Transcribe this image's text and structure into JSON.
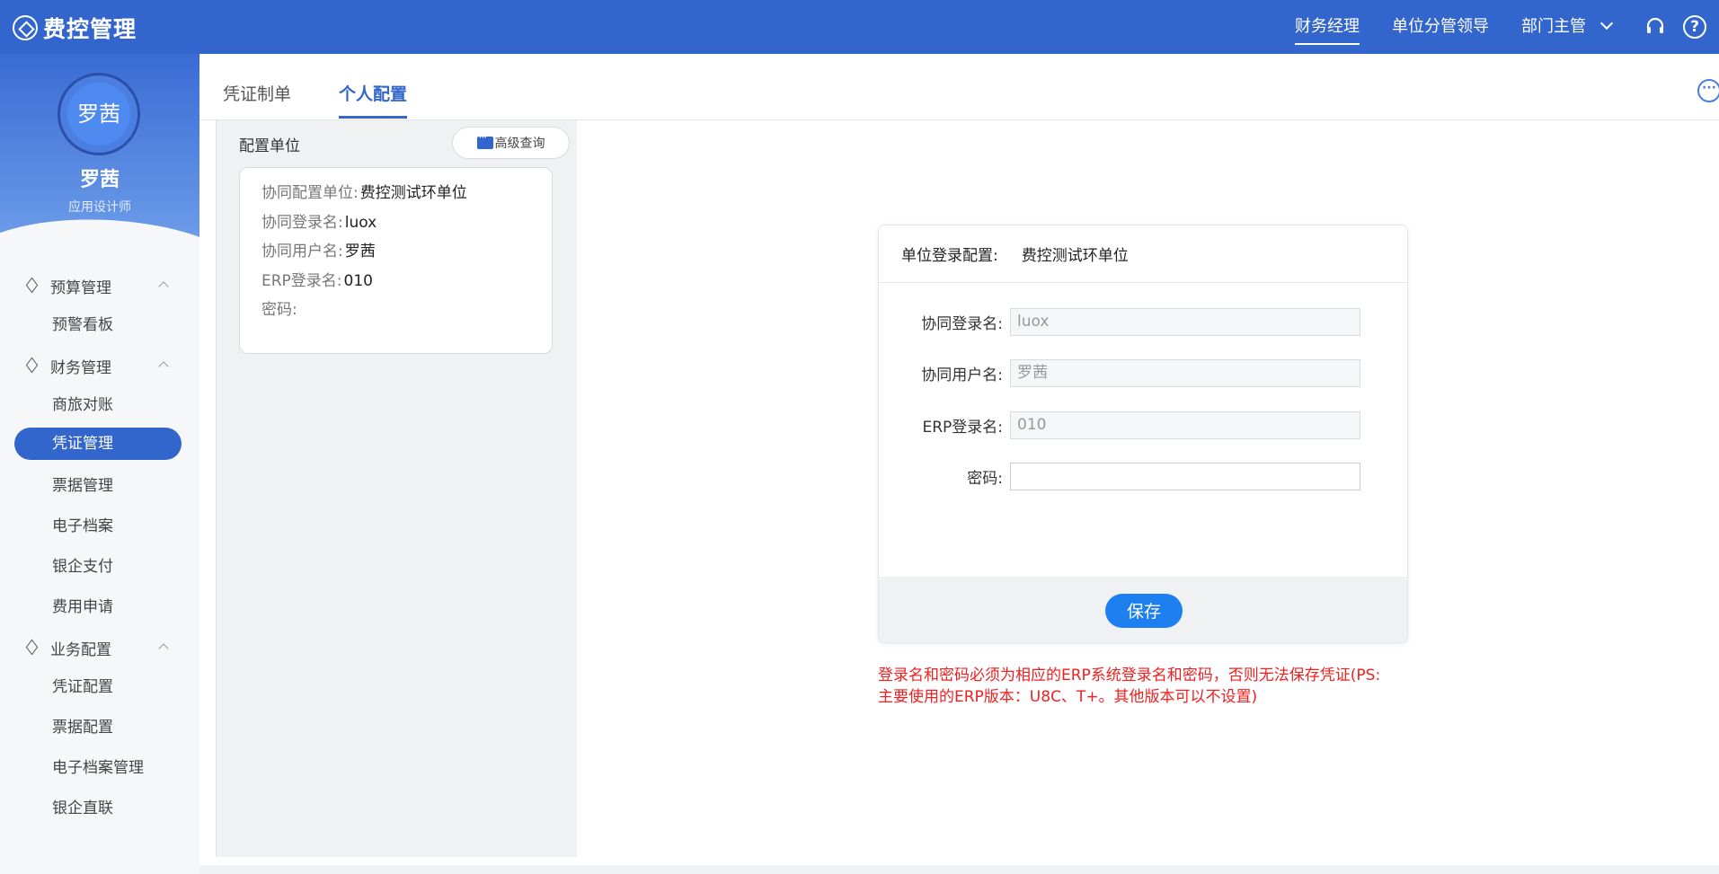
{
  "app": {
    "title": "费控管理",
    "logo_icon": "app-logo-icon"
  },
  "header": {
    "roles": [
      "财务经理",
      "单位分管领导",
      "部门主管"
    ],
    "active_role": "财务经理",
    "icons": [
      "headset-icon",
      "help-icon"
    ],
    "help_glyph": "?"
  },
  "profile": {
    "avatar_text": "罗茜",
    "name": "罗茜",
    "role": "应用设计师"
  },
  "sidebar": {
    "groups": [
      {
        "label": "预算管理",
        "items": [
          "预警看板"
        ]
      },
      {
        "label": "财务管理",
        "items": [
          "商旅对账",
          "凭证管理",
          "票据管理",
          "电子档案",
          "银企支付",
          "费用申请"
        ]
      },
      {
        "label": "业务配置",
        "items": [
          "凭证配置",
          "票据配置",
          "电子档案管理",
          "银企直联"
        ]
      }
    ],
    "active_item": "凭证管理"
  },
  "tabs": {
    "items": [
      "凭证制单",
      "个人配置"
    ],
    "active": "个人配置",
    "more_glyph": "···"
  },
  "left_panel": {
    "title": "配置单位",
    "adv_search_label": "高级查询",
    "card": {
      "unit_label": "协同配置单位:",
      "unit_value": "费控测试环单位",
      "login_label": "协同登录名:",
      "login_value": "luox",
      "user_label": "协同用户名:",
      "user_value": "罗茜",
      "erp_label": "ERP登录名:",
      "erp_value": "010",
      "pwd_label": "密码:",
      "pwd_value": ""
    }
  },
  "form": {
    "header_label": "单位登录配置:",
    "header_value": "费控测试环单位",
    "login_label": "协同登录名:",
    "login_value": "luox",
    "user_label": "协同用户名:",
    "user_value": "罗茜",
    "erp_label": "ERP登录名:",
    "erp_value": "010",
    "pwd_label": "密码:",
    "pwd_value": "",
    "save_label": "保存"
  },
  "warning": {
    "line1": "登录名和密码必须为相应的ERP系统登录名和密码，否则无法保存凭证(PS:",
    "line2": "主要使用的ERP版本：U8C、T+。其他版本可以不设置)"
  },
  "colors": {
    "primary": "#3366cc",
    "button": "#1e80f0",
    "warning": "#f02020"
  }
}
